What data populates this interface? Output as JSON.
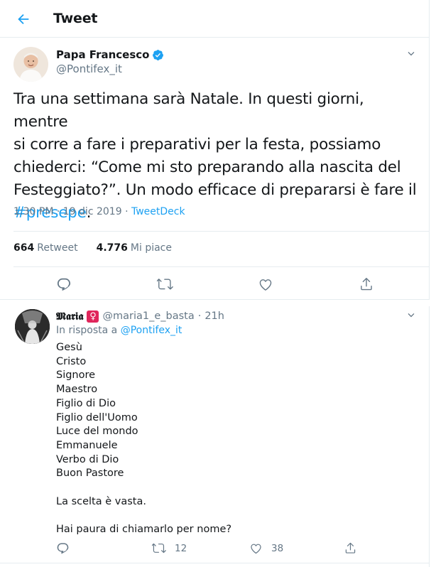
{
  "header": {
    "title": "Tweet"
  },
  "tweet": {
    "author_name": "Papa Francesco",
    "author_handle": "@Pontifex_it",
    "text_lines": [
      "Tra una settimana sarà Natale. In questi giorni, mentre",
      "si corre a fare i preparativi per la festa, possiamo",
      "chiederci: “Come mi sto preparando alla nascita del",
      "Festeggiato?”. Un modo efficace di prepararsi è fare il"
    ],
    "hashtag": "#presepe",
    "hashtag_suffix": ".",
    "time": "1:30 PM",
    "date": "19 dic 2019",
    "source": "TweetDeck",
    "retweets_count": "664",
    "retweets_label": "Retweet",
    "likes_count": "4.776",
    "likes_label": "Mi piace"
  },
  "reply": {
    "author_name": "𝕸𝖆𝖗𝖎𝖆",
    "emoji": "♀",
    "author_handle": "@maria1_e_basta",
    "time": "21h",
    "in_reply_prefix": "In risposta a",
    "in_reply_mention": "@Pontifex_it",
    "lines": [
      "Gesù",
      "Cristo",
      "Signore",
      "Maestro",
      "Figlio di Dio",
      "Figlio dell'Uomo",
      "Luce del mondo",
      "Emmanuele",
      "Verbo di Dio",
      "Buon Pastore"
    ],
    "line_a": "La scelta è vasta.",
    "line_b": "Hai paura di chiamarlo per nome?",
    "retweets": "12",
    "likes": "38"
  },
  "colors": {
    "accent": "#1da1f2",
    "muted": "#657786",
    "border": "#e6ecf0",
    "venus_bg": "#e0265b"
  },
  "icons": [
    "back-arrow-icon",
    "verified-badge-icon",
    "chevron-down-icon",
    "reply-icon",
    "retweet-icon",
    "like-icon",
    "share-icon"
  ]
}
